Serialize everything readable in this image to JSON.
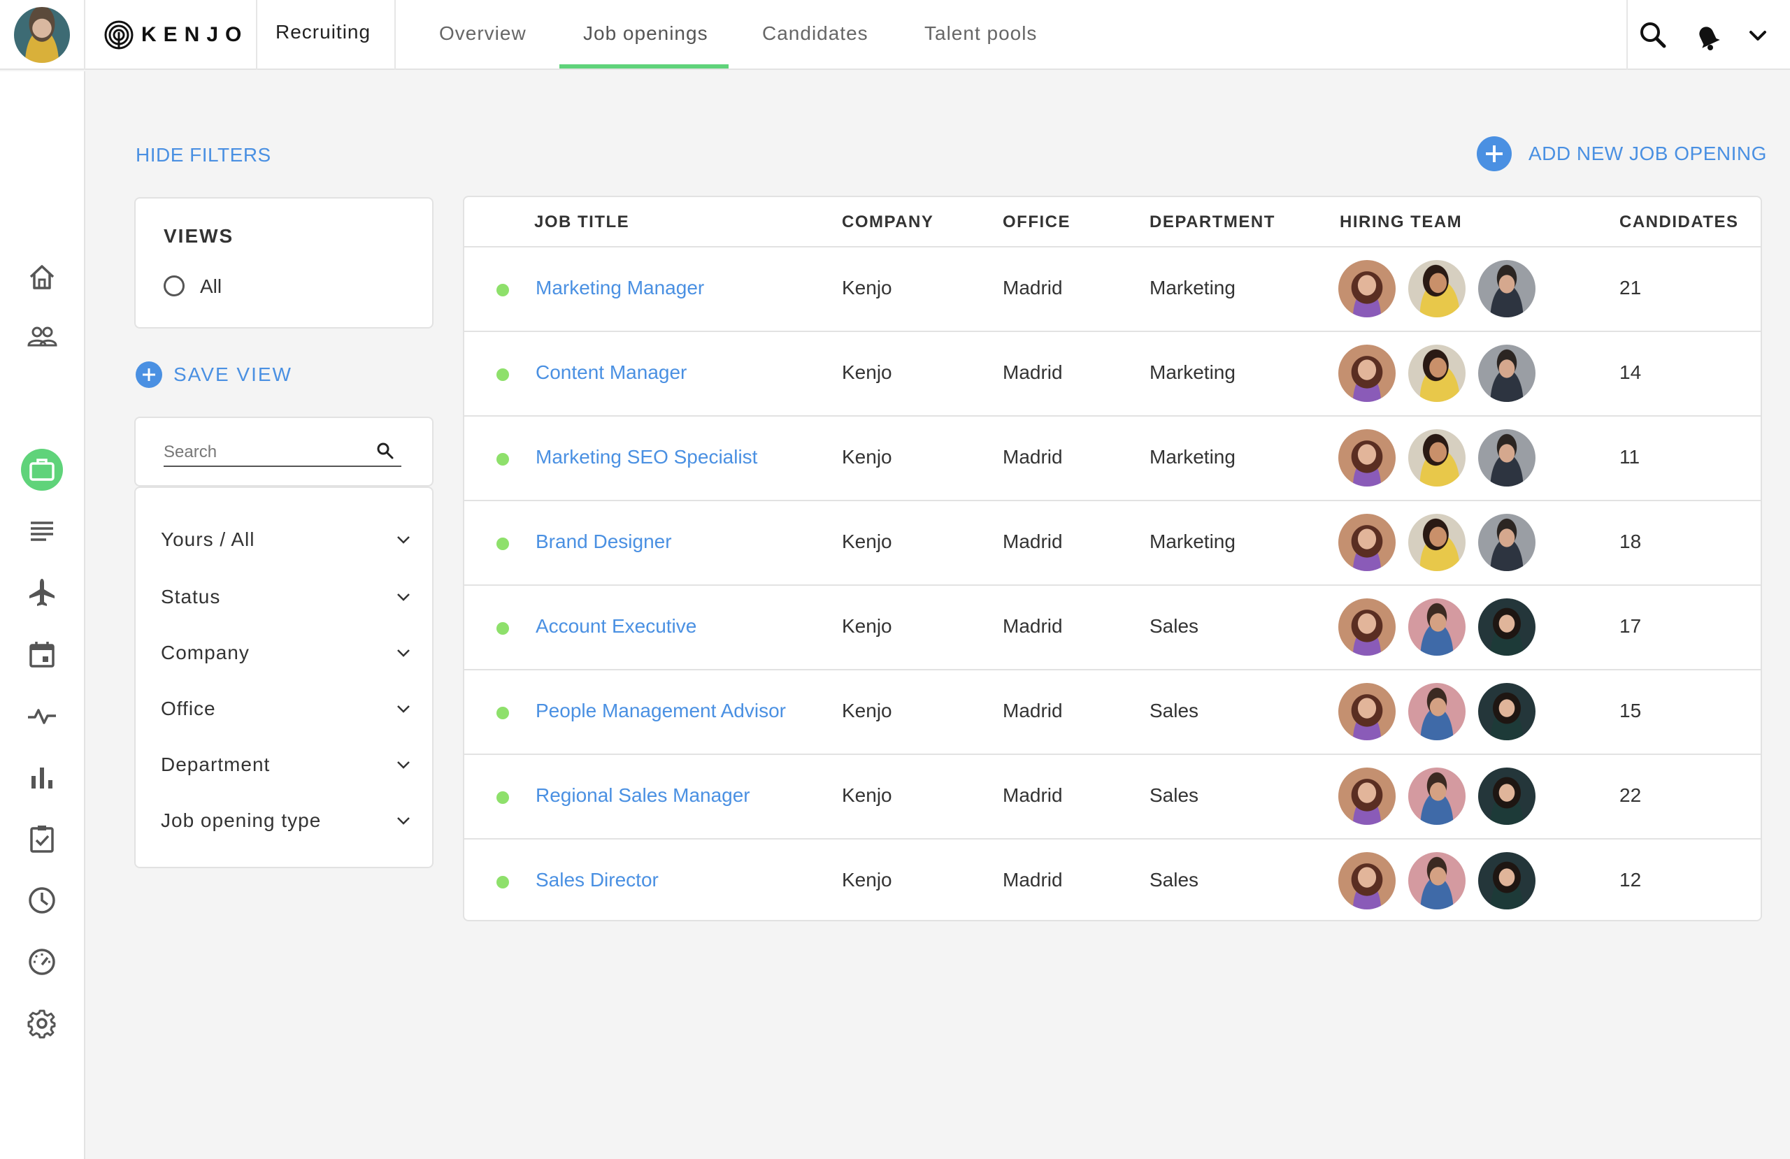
{
  "app": {
    "logo_text": "KENJO",
    "module_title": "Recruiting"
  },
  "nav": {
    "tabs": [
      {
        "label": "Overview"
      },
      {
        "label": "Job openings",
        "active": true
      },
      {
        "label": "Candidates"
      },
      {
        "label": "Talent pools"
      }
    ]
  },
  "topbar_icons": [
    "search-icon",
    "notification-bell-icon",
    "chevron-down-icon"
  ],
  "sidebar": {
    "icons": [
      "home-icon",
      "people-icon",
      "briefcase-icon",
      "list-icon",
      "airplane-icon",
      "calendar-icon",
      "pulse-icon",
      "bar-chart-icon",
      "checklist-icon",
      "clock-icon",
      "gauge-icon",
      "gear-icon"
    ],
    "active": "briefcase-icon"
  },
  "colors": {
    "accent_green": "#5fd37a",
    "link_blue": "#4a90e2",
    "status_dot": "#8ee06b"
  },
  "actions": {
    "hide_filters": "HIDE FILTERS",
    "add_new_job_opening": "ADD NEW JOB OPENING",
    "save_view": "SAVE VIEW"
  },
  "views": {
    "title": "VIEWS",
    "options": [
      {
        "label": "All",
        "selected": false
      }
    ]
  },
  "search": {
    "placeholder": "Search",
    "value": ""
  },
  "filters": [
    {
      "label": "Yours / All"
    },
    {
      "label": "Status"
    },
    {
      "label": "Company"
    },
    {
      "label": "Office"
    },
    {
      "label": "Department"
    },
    {
      "label": "Job opening type"
    }
  ],
  "table": {
    "columns": [
      "JOB TITLE",
      "COMPANY",
      "OFFICE",
      "DEPARTMENT",
      "HIRING TEAM",
      "CANDIDATES"
    ],
    "rows": [
      {
        "title": "Marketing Manager",
        "company": "Kenjo",
        "office": "Madrid",
        "department": "Marketing",
        "team": [
          "av-a",
          "av-b",
          "av-c"
        ],
        "candidates": "21"
      },
      {
        "title": "Content Manager",
        "company": "Kenjo",
        "office": "Madrid",
        "department": "Marketing",
        "team": [
          "av-a",
          "av-b",
          "av-c"
        ],
        "candidates": "14"
      },
      {
        "title": "Marketing SEO Specialist",
        "company": "Kenjo",
        "office": "Madrid",
        "department": "Marketing",
        "team": [
          "av-a",
          "av-b",
          "av-c"
        ],
        "candidates": "11"
      },
      {
        "title": "Brand Designer",
        "company": "Kenjo",
        "office": "Madrid",
        "department": "Marketing",
        "team": [
          "av-a",
          "av-b",
          "av-c"
        ],
        "candidates": "18"
      },
      {
        "title": "Account Executive",
        "company": "Kenjo",
        "office": "Madrid",
        "department": "Sales",
        "team": [
          "av-a",
          "av-d",
          "av-e"
        ],
        "candidates": "17"
      },
      {
        "title": "People Management Advisor",
        "company": "Kenjo",
        "office": "Madrid",
        "department": "Sales",
        "team": [
          "av-a",
          "av-d",
          "av-e"
        ],
        "candidates": "15"
      },
      {
        "title": "Regional Sales Manager",
        "company": "Kenjo",
        "office": "Madrid",
        "department": "Sales",
        "team": [
          "av-a",
          "av-d",
          "av-e"
        ],
        "candidates": "22"
      },
      {
        "title": "Sales Director",
        "company": "Kenjo",
        "office": "Madrid",
        "department": "Sales",
        "team": [
          "av-a",
          "av-d",
          "av-e"
        ],
        "candidates": "12"
      }
    ]
  }
}
